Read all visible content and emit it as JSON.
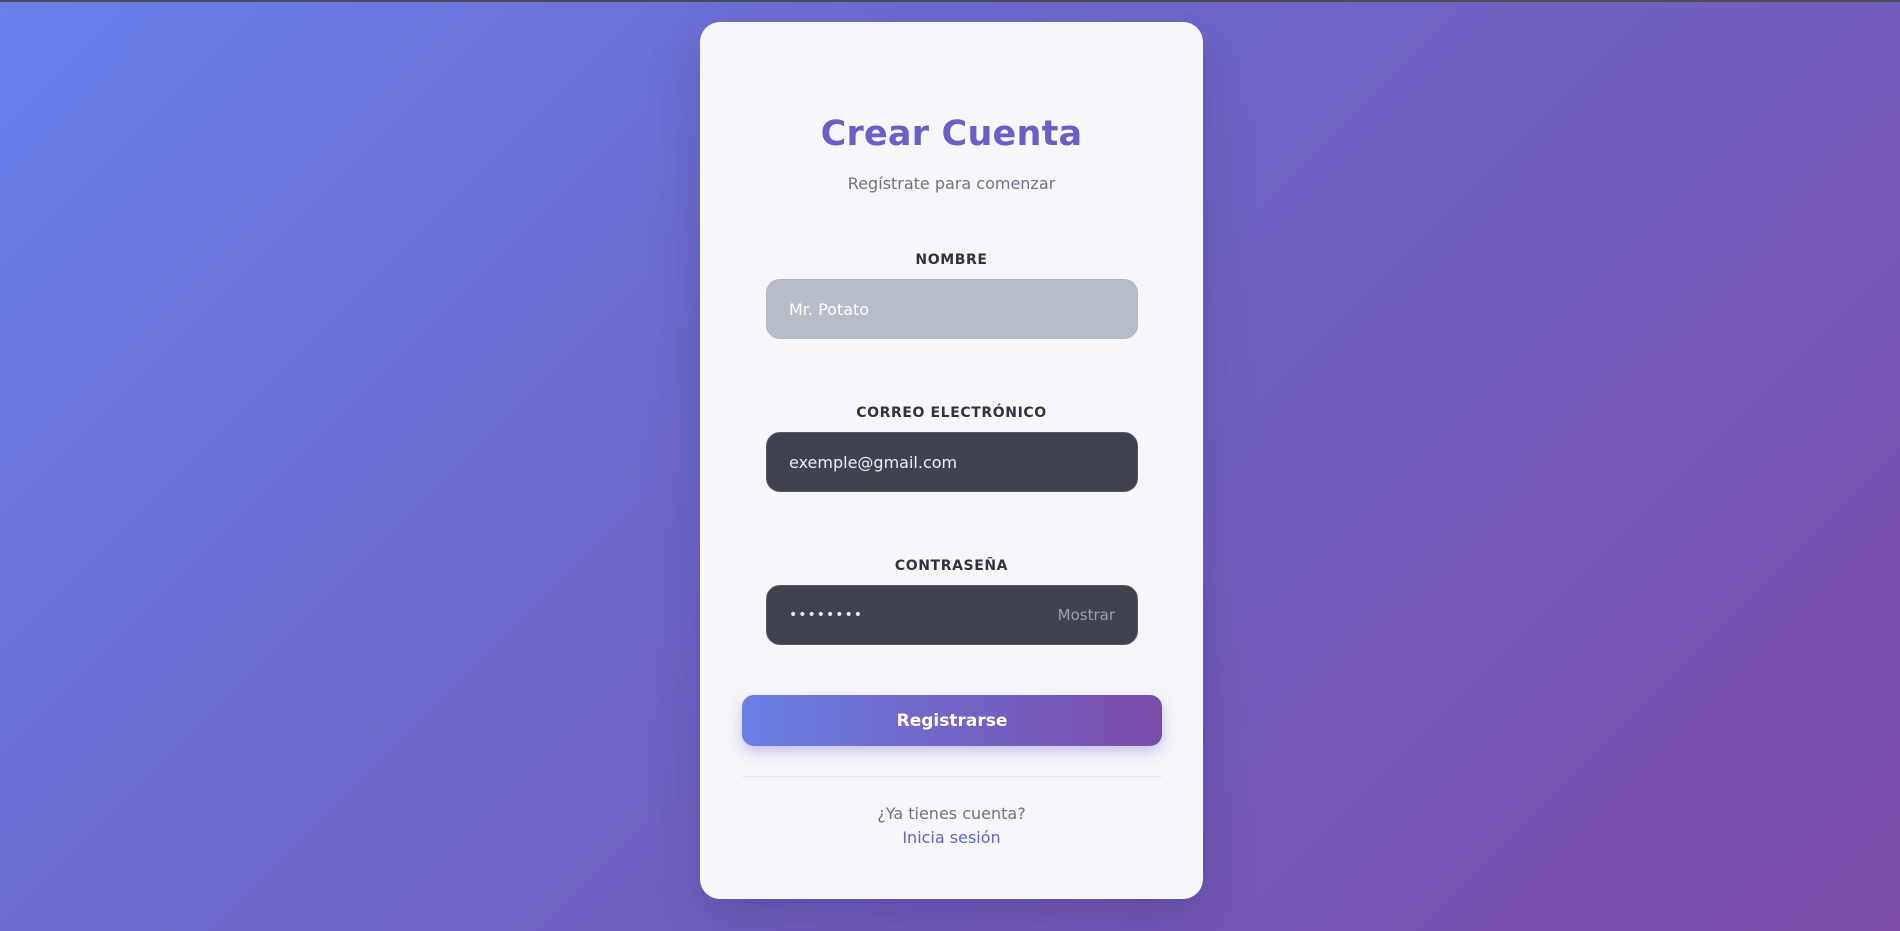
{
  "form": {
    "title": "Crear Cuenta",
    "subtitle": "Regístrate para comenzar",
    "name": {
      "label": "NOMBRE",
      "placeholder": "Mr. Potato"
    },
    "email": {
      "label": "CORREO ELECTRÓNICO",
      "value": "exemple@gmail.com"
    },
    "password": {
      "label": "CONTRASEÑA",
      "masked_value": "••••••••",
      "toggle_label": "Mostrar"
    },
    "submit_label": "Registrarse",
    "footer": {
      "question": "¿Ya tienes cuenta?",
      "login_link": "Inicia sesión"
    }
  },
  "colors": {
    "accent": "#6a5fc6",
    "gradient_start": "#6a80ea",
    "gradient_end": "#7a4ba8",
    "link": "#5f63d6"
  }
}
